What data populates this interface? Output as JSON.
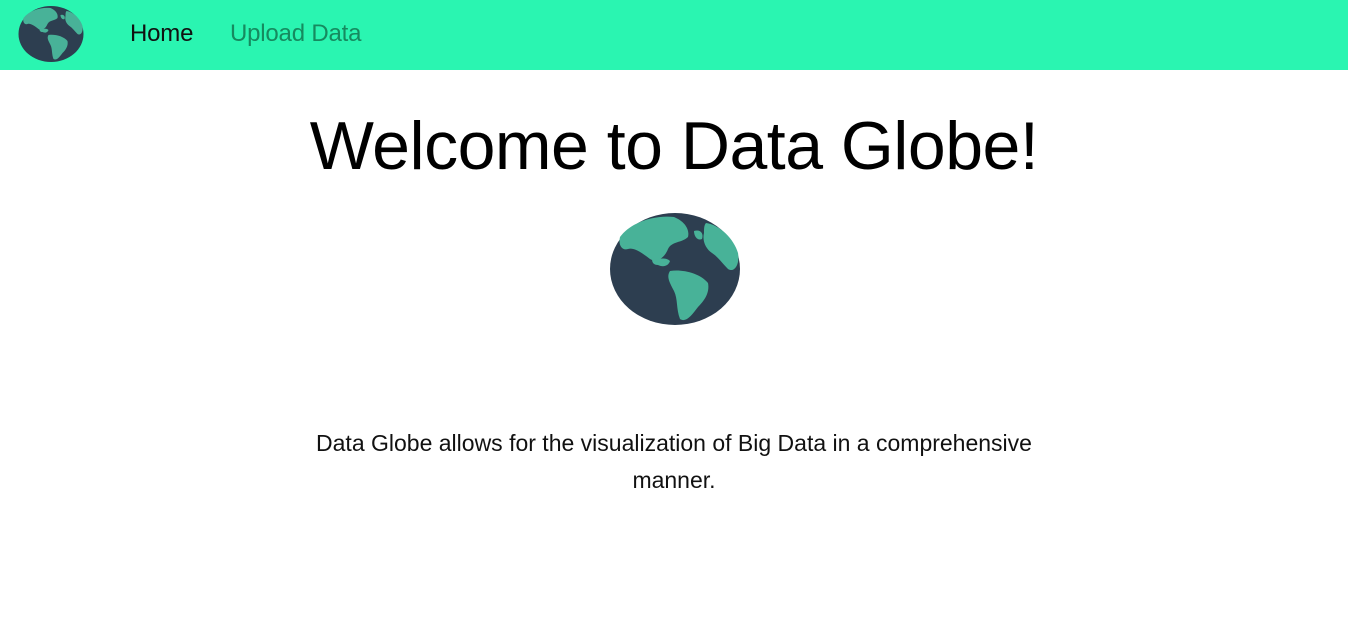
{
  "nav": {
    "logo_icon": "globe-icon",
    "links": [
      {
        "label": "Home",
        "active": true
      },
      {
        "label": "Upload Data",
        "active": false
      }
    ]
  },
  "hero": {
    "title": "Welcome to Data Globe!",
    "image_icon": "globe-icon",
    "description": "Data Globe allows for the visualization of Big Data in a comprehensive manner."
  },
  "colors": {
    "navbar_bg": "#2af5b1",
    "nav_active": "#111111",
    "nav_inactive": "#168a5f",
    "globe_ocean": "#2d3e50",
    "globe_land": "#48b298"
  }
}
